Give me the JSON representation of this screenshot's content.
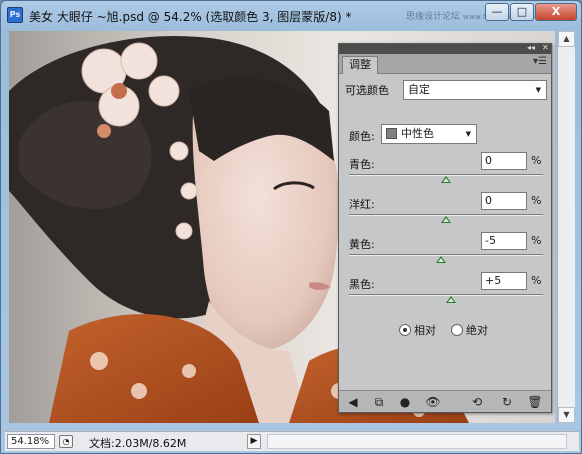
{
  "window": {
    "app_icon": "Ps",
    "title": "美女 大眼仔 ~旭.psd @ 54.2% (选取颜色 3, 图层蒙版/8) *",
    "watermark": "思缘设计论坛",
    "watermark_url": "www.MISSYUAN.COM",
    "minimize": "—",
    "restore": "□",
    "close": "X"
  },
  "panel": {
    "tab": "调整",
    "title": "可选颜色",
    "preset": "自定",
    "color_label": "颜色:",
    "color_value": "中性色",
    "sliders": [
      {
        "label": "青色:",
        "value": "0",
        "unit": "%",
        "level": 0
      },
      {
        "label": "洋红:",
        "value": "0",
        "unit": "%",
        "level": 0
      },
      {
        "label": "黄色:",
        "value": "-5",
        "unit": "%",
        "level": -5
      },
      {
        "label": "黑色:",
        "value": "+5",
        "unit": "%",
        "level": 5
      }
    ],
    "method_relative": "相对",
    "method_absolute": "绝对",
    "method_selected": "relative"
  },
  "status": {
    "zoom": "54.18%",
    "doc_info": "文档:2.03M/8.62M"
  },
  "colors": {
    "accent": "#2a7a2a",
    "kimono": "#b8531e",
    "hair": "#2b2624"
  }
}
